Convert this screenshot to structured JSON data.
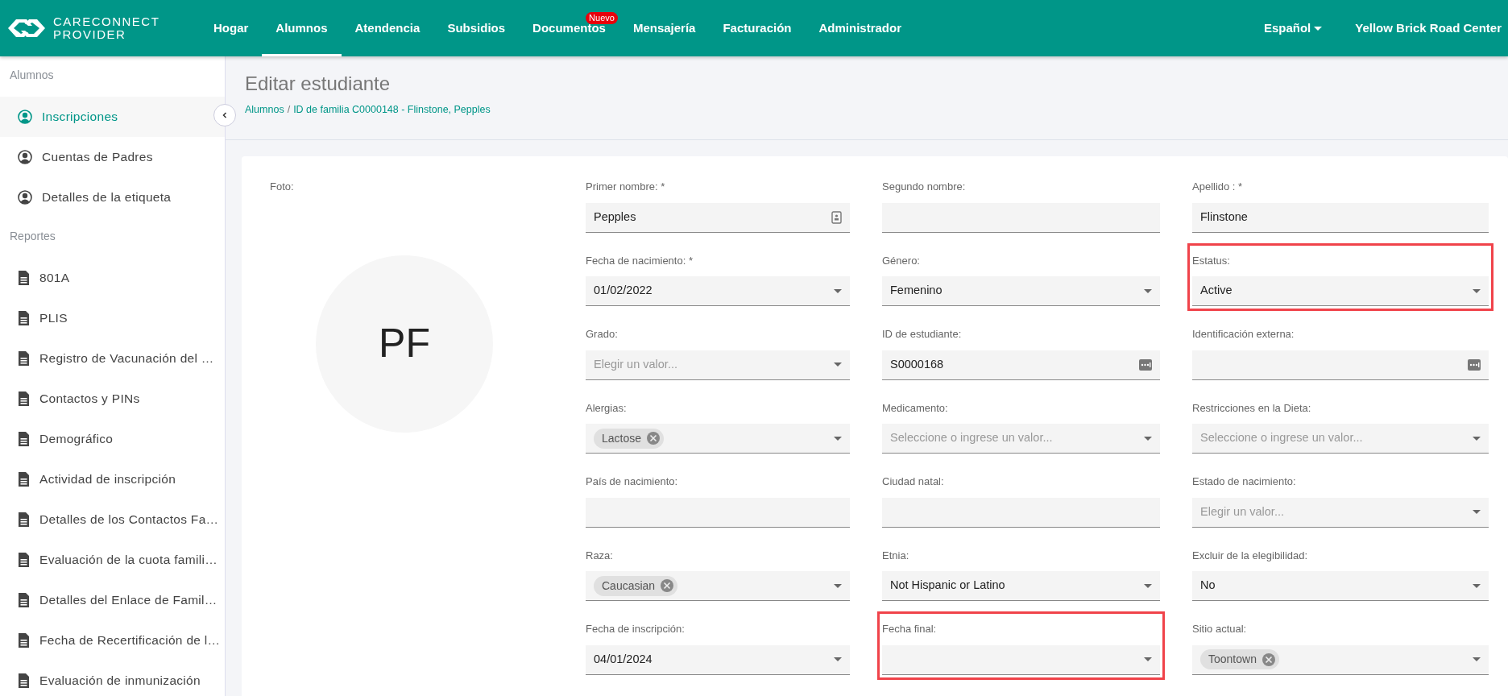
{
  "brand": {
    "line1": "CARECONNECT",
    "line2": "PROVIDER"
  },
  "nav": [
    {
      "label": "Hogar",
      "selected": false
    },
    {
      "label": "Alumnos",
      "selected": true
    },
    {
      "label": "Atendencia",
      "selected": false
    },
    {
      "label": "Subsidios",
      "selected": false
    },
    {
      "label": "Documentos",
      "selected": false,
      "badge": "Nuevo"
    },
    {
      "label": "Mensajería",
      "selected": false
    },
    {
      "label": "Facturación",
      "selected": false
    },
    {
      "label": "Administrador",
      "selected": false
    }
  ],
  "language": "Español",
  "center": "Yellow Brick Road Center",
  "sidebar": [
    {
      "heading": "Alumnos",
      "items": [
        {
          "label": "Inscripciones",
          "kind": "person",
          "selected": true
        },
        {
          "label": "Cuentas de Padres",
          "kind": "person",
          "selected": false
        },
        {
          "label": "Detalles de la etiqueta",
          "kind": "person",
          "selected": false
        }
      ]
    },
    {
      "heading": "Reportes",
      "items": [
        {
          "label": "801A",
          "kind": "report",
          "selected": false
        },
        {
          "label": "PLIS",
          "kind": "report",
          "selected": false
        },
        {
          "label": "Registro de Vacunación del …",
          "kind": "report",
          "selected": false
        },
        {
          "label": "Contactos y PINs",
          "kind": "report",
          "selected": false
        },
        {
          "label": "Demográfico",
          "kind": "report",
          "selected": false
        },
        {
          "label": "Actividad de inscripción",
          "kind": "report",
          "selected": false
        },
        {
          "label": "Detalles de los Contactos Fa…",
          "kind": "report",
          "selected": false
        },
        {
          "label": "Evaluación de la cuota famili…",
          "kind": "report",
          "selected": false
        },
        {
          "label": "Detalles del Enlace de Famil…",
          "kind": "report",
          "selected": false
        },
        {
          "label": "Fecha de Recertificación de l…",
          "kind": "report",
          "selected": false
        },
        {
          "label": "Evaluación de inmunización",
          "kind": "report",
          "selected": false
        }
      ]
    }
  ],
  "page_title": "Editar estudiante",
  "breadcrumb": [
    "Alumnos",
    "ID de familia C0000148 - Flinstone, Pepples"
  ],
  "breadcrumb_separator": "/",
  "photo": {
    "label": "Foto:",
    "initials": "PF"
  },
  "fields": [
    {
      "label": "Primer nombre: *",
      "kind": "contact",
      "value": "Pepples",
      "highlighted": false
    },
    {
      "label": "Segundo nombre:",
      "kind": "text",
      "highlighted": false
    },
    {
      "label": "Apellido : *",
      "kind": "text",
      "value": "Flinstone",
      "highlighted": false
    },
    {
      "label": "Fecha de nacimiento: *",
      "kind": "select",
      "value": "01/02/2022",
      "highlighted": false
    },
    {
      "label": "Género:",
      "kind": "select",
      "value": "Femenino",
      "highlighted": false
    },
    {
      "label": "Estatus:",
      "kind": "select",
      "value": "Active",
      "highlighted": true
    },
    {
      "label": "Grado:",
      "kind": "select",
      "placeholder": "Elegir un valor...",
      "highlighted": false
    },
    {
      "label": "ID de estudiante:",
      "kind": "code",
      "value": "S0000168",
      "highlighted": false
    },
    {
      "label": "Identificación externa:",
      "kind": "code",
      "highlighted": false
    },
    {
      "label": "Alergias:",
      "kind": "tags",
      "tags": [
        "Lactose"
      ],
      "highlighted": false
    },
    {
      "label": "Medicamento:",
      "kind": "select",
      "placeholder": "Seleccione o ingrese un valor...",
      "highlighted": false
    },
    {
      "label": "Restricciones en la Dieta:",
      "kind": "select",
      "placeholder": "Seleccione o ingrese un valor...",
      "highlighted": false
    },
    {
      "label": "País de nacimiento:",
      "kind": "text",
      "highlighted": false
    },
    {
      "label": "Ciudad natal:",
      "kind": "text",
      "highlighted": false
    },
    {
      "label": "Estado de nacimiento:",
      "kind": "select",
      "placeholder": "Elegir un valor...",
      "highlighted": false
    },
    {
      "label": "Raza:",
      "kind": "tags",
      "tags": [
        "Caucasian"
      ],
      "highlighted": false
    },
    {
      "label": "Etnia:",
      "kind": "select",
      "value": "Not Hispanic or Latino",
      "highlighted": false
    },
    {
      "label": "Excluir de la elegibilidad:",
      "kind": "select",
      "value": "No",
      "highlighted": false
    },
    {
      "label": "Fecha de inscripción:",
      "kind": "select",
      "value": "04/01/2024",
      "highlighted": false
    },
    {
      "label": "Fecha final:",
      "kind": "select",
      "highlighted": true
    },
    {
      "label": "Sitio actual:",
      "kind": "tags",
      "tags": [
        "Toontown"
      ],
      "highlighted": false
    }
  ]
}
